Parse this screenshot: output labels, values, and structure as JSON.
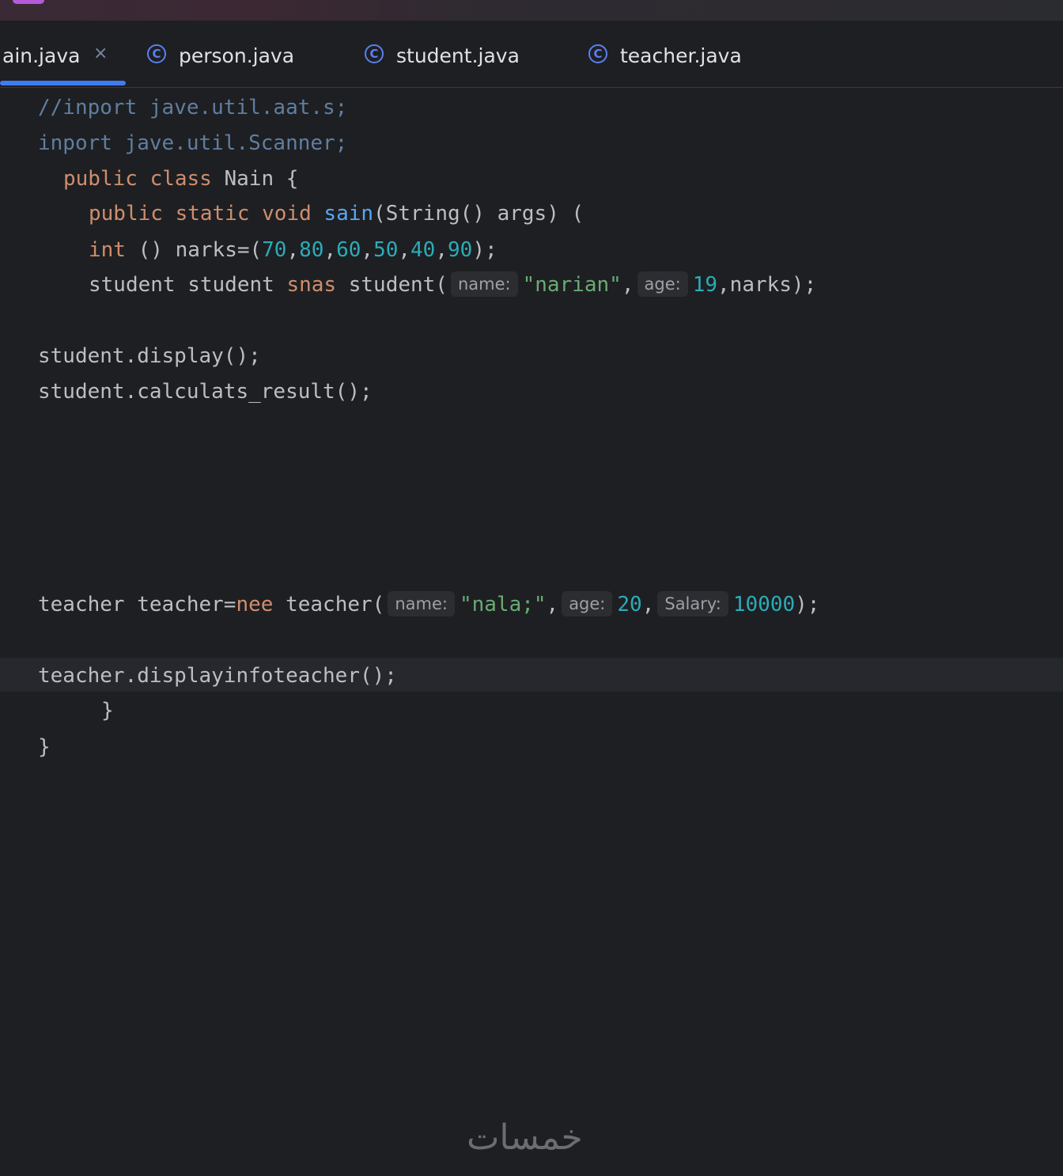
{
  "tabs": [
    {
      "label": "ain.java",
      "active": true,
      "close": "×"
    },
    {
      "label": "person.java",
      "icon_glyph": "C"
    },
    {
      "label": "student.java",
      "icon_glyph": "C"
    },
    {
      "label": "teacher.java",
      "icon_glyph": "C"
    }
  ],
  "code": {
    "l1": {
      "comment": "//inport jave.util.aat.s;"
    },
    "l2": {
      "text": "inport jave.util.Scanner;"
    },
    "l3": {
      "kw": "public class",
      "rest": " Nain {"
    },
    "l4": {
      "kw": "public static void",
      "fn": "sain",
      "rest": "(String() args) ("
    },
    "l5": {
      "kw": "int",
      "mid": " () narks=(",
      "n1": "70",
      "n2": "80",
      "n3": "60",
      "n4": "50",
      "n5": "40",
      "n6": "90",
      "comma": ",",
      "end": ");"
    },
    "l6": {
      "a": "student student ",
      "kw": "snas",
      "b": " student(",
      "hint_name": "name:",
      "str": "\"narian\"",
      "comma": ",",
      "hint_age": "age:",
      "num": "19",
      "end": ",narks);"
    },
    "l7": {
      "text": "student.display();"
    },
    "l8": {
      "text": "student.calculats_result();"
    },
    "l9": {
      "a": "teacher teacher=",
      "kw": "nee",
      "b": " teacher(",
      "hint_name": "name:",
      "str": "\"nala;\"",
      "comma": ",",
      "hint_age": "age:",
      "num": "20",
      "comma2": ",",
      "hint_salary": "Salary:",
      "num2": "10000",
      "end": ");"
    },
    "l10": {
      "text": "teacher.displayinfoteacher();"
    },
    "l11": {
      "text": "}"
    },
    "l12": {
      "text": "}"
    }
  },
  "watermark": "خمسات",
  "colors": {
    "background": "#1e1f22",
    "keyword": "#cf8e6d",
    "function": "#56a8f5",
    "number": "#2aacb8",
    "string": "#6aab73",
    "comment": "#5f7ea1",
    "tab_underline": "#3d7cf4",
    "class_icon": "#5b7ff0"
  }
}
